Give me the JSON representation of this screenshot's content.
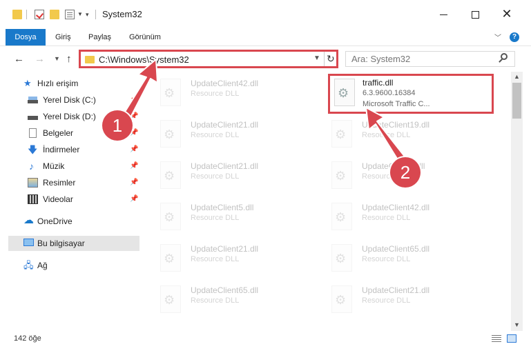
{
  "window": {
    "title": "System32",
    "quick_access_arrow": "▾"
  },
  "ribbon": {
    "tabs": [
      {
        "label": "Dosya",
        "active": true
      },
      {
        "label": "Giriş"
      },
      {
        "label": "Paylaş"
      },
      {
        "label": "Görünüm"
      }
    ],
    "help_glyph": "?"
  },
  "address_bar": {
    "path": "C:\\Windows\\System32",
    "search_placeholder": "Ara: System32"
  },
  "nav_pane": {
    "items": [
      {
        "label": "Hızlı erişim",
        "icon": "star-icon"
      },
      {
        "label": "Yerel Disk (C:)",
        "icon": "drive-icon",
        "pinned": true
      },
      {
        "label": "Yerel Disk (D:)",
        "icon": "drive-icon",
        "pinned": true
      },
      {
        "label": "Belgeler",
        "icon": "documents-icon",
        "pinned": true
      },
      {
        "label": "İndirmeler",
        "icon": "downloads-icon",
        "pinned": true
      },
      {
        "label": "Müzik",
        "icon": "music-icon",
        "pinned": true
      },
      {
        "label": "Resimler",
        "icon": "pictures-icon",
        "pinned": true
      },
      {
        "label": "Videolar",
        "icon": "videos-icon",
        "pinned": true
      },
      {
        "label": "OneDrive",
        "icon": "cloud-icon"
      },
      {
        "label": "Bu bilgisayar",
        "icon": "computer-icon",
        "selected": true
      },
      {
        "label": "Ağ",
        "icon": "network-icon"
      }
    ]
  },
  "files": [
    {
      "name": "UpdateClient42.dll",
      "type": "Resource DLL"
    },
    {
      "name": "traffic.dll",
      "version": "6.3.9600.16384",
      "description": "Microsoft Traffic C...",
      "highlighted": true
    },
    {
      "name": "UpdateClient21.dll",
      "type": "Resource DLL"
    },
    {
      "name": "UpdateClient19.dll",
      "type": "Resource DLL"
    },
    {
      "name": "UpdateClient21.dll",
      "type": "Resource DLL"
    },
    {
      "name": "UpdateClient5.dll",
      "type": "Resource DLL"
    },
    {
      "name": "UpdateClient5.dll",
      "type": "Resource DLL"
    },
    {
      "name": "UpdateClient42.dll",
      "type": "Resource DLL"
    },
    {
      "name": "UpdateClient21.dll",
      "type": "Resource DLL"
    },
    {
      "name": "UpdateClient65.dll",
      "type": "Resource DLL"
    },
    {
      "name": "UpdateClient65.dll",
      "type": "Resource DLL"
    },
    {
      "name": "UpdateClient21.dll",
      "type": "Resource DLL"
    }
  ],
  "status_bar": {
    "item_count": "142 öğe"
  },
  "annotations": {
    "step1": "1",
    "step2": "2",
    "color": "#d9474f"
  }
}
